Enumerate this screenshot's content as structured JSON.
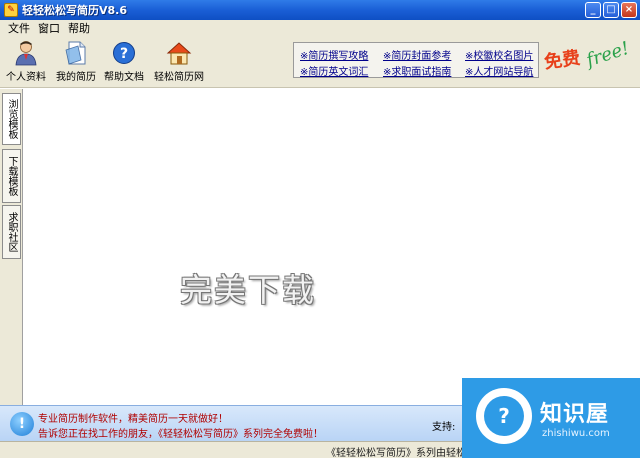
{
  "window": {
    "title": "轻轻松松写简历V8.6"
  },
  "menu": {
    "items": [
      "文件",
      "窗口",
      "帮助"
    ]
  },
  "toolbar": {
    "buttons": [
      {
        "label": "个人资料",
        "icon": "person-icon"
      },
      {
        "label": "我的简历",
        "icon": "document-icon"
      },
      {
        "label": "帮助文档",
        "icon": "help-icon"
      },
      {
        "label": "轻松简历网",
        "icon": "home-icon"
      }
    ],
    "links": [
      "※简历撰写攻略",
      "※简历封面参考",
      "※校徽校名图片",
      "※简历英文词汇",
      "※求职面试指南",
      "※人才网站导航"
    ],
    "free_badge_cn": "免费",
    "free_badge_en": "free!"
  },
  "tabs": [
    "浏览模板",
    "下载模板",
    "求职社区"
  ],
  "main": {
    "watermark": "完美下载"
  },
  "infobar": {
    "line1": "专业简历制作软件，精美简历一天就做好！",
    "line2": "告诉您正在找工作的朋友，《轻轻松松写简历》系列完全免费啦！",
    "support": "支持:"
  },
  "statusbar": {
    "text": "《轻轻松松写简历》系列由轻松简历网 easyresume.net"
  },
  "brand": {
    "name": "知识屋",
    "url": "zhishiwu.com"
  },
  "colors": {
    "titlebar": "#1a5fd6",
    "infobar": "#c6dcf7",
    "brand": "#2e9be6",
    "info_text": "#b00000"
  }
}
